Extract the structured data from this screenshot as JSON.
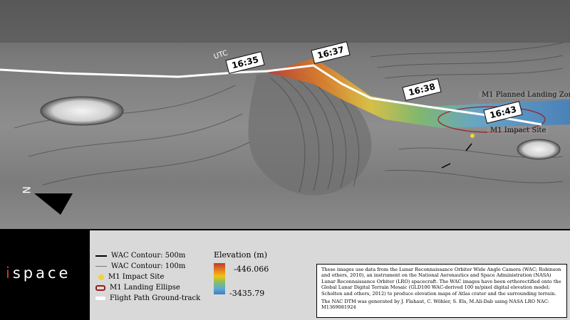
{
  "map": {
    "utc_label": "UTC",
    "times": [
      "16:35",
      "16:37",
      "16:38",
      "16:43"
    ],
    "labels": {
      "planned_zone": "M1 Planned Landing Zone",
      "impact_site": "M1 Impact Site"
    },
    "north_icon": "north-arrow-icon"
  },
  "brand": {
    "prefix": "i",
    "suffix": "space"
  },
  "legend": {
    "contour_500": "WAC Contour: 500m",
    "contour_100": "WAC Contour: 100m",
    "impact_site": "M1 Impact Site",
    "landing_ellipse": "M1 Landing Ellipse",
    "flight_path": "Flight Path Ground-track",
    "elevation_title": "Elevation (m)",
    "elevation_max": "-446.066",
    "elevation_min": "-3435.79",
    "colors": {
      "impact": "#f2d62e",
      "ellipse": "#9b1c1c",
      "path": "#ffffff"
    }
  },
  "credits": {
    "para1": "These images use data from the Lunar Reconnaissance Orbiter Wide Angle Camera (WAC; Robinson and others, 2010), an instrument on the National Aeronautics and Space Administration (NASA) Lunar Reconnaissance Orbiter (LRO) spacecraft. The WAC images have been orthorectified onto the Global Lunar Digital Terrain Mosaic (GLD100 WAC-derived 100 m/pixel digital elevation model; Scholten and others, 2012) to produce elevation maps of Atlas crater and the surrounding terrain.",
    "para2": "The NAC DTM was generated by J. Flahaut, C. Wöhler, S. Els, M.Ali-Dab using NASA LRO NAC: M1369081924"
  }
}
